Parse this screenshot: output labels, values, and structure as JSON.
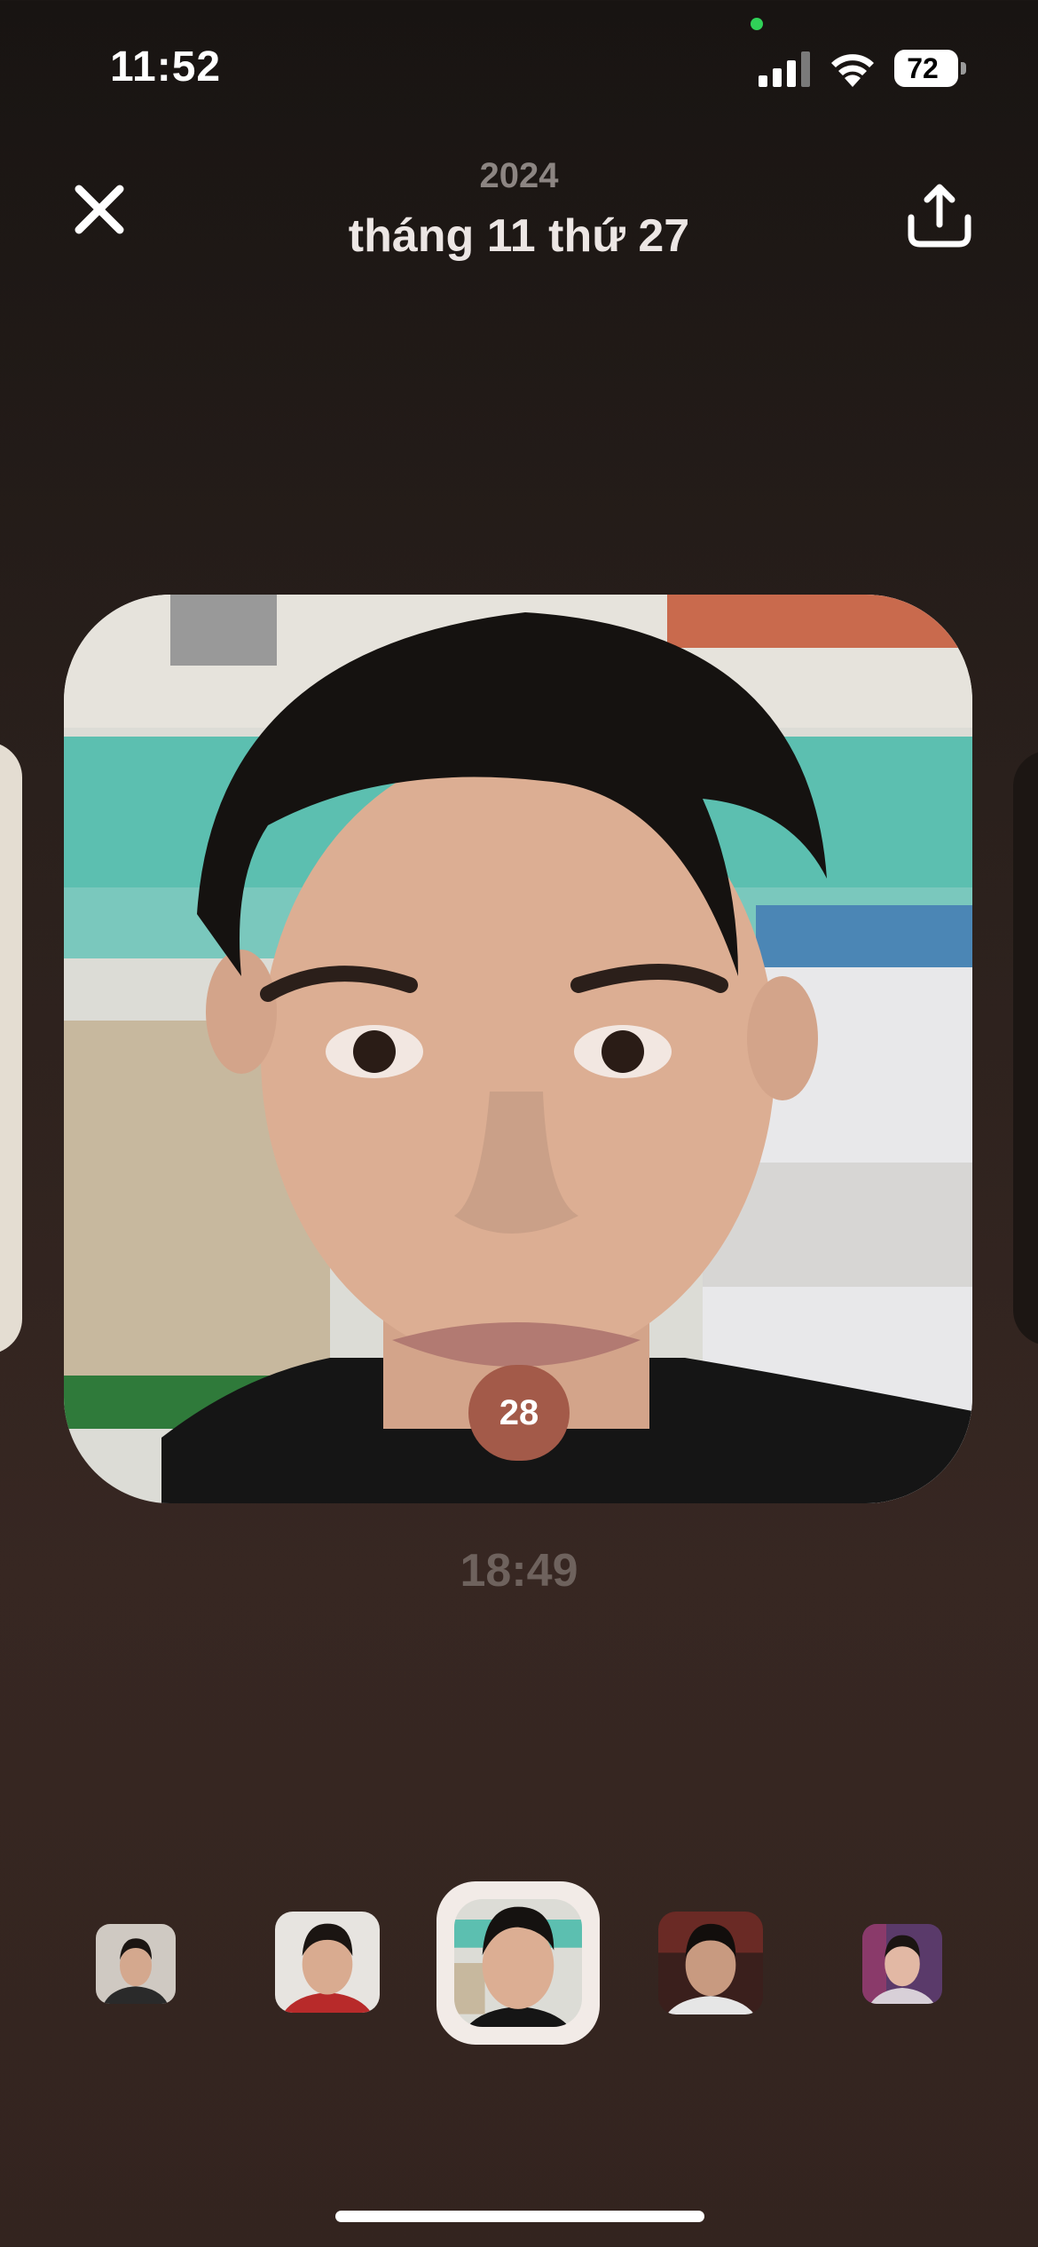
{
  "status_bar": {
    "time": "11:52",
    "battery": "72",
    "icons": [
      "cell-signal-icon",
      "wifi-icon",
      "battery-icon"
    ]
  },
  "header": {
    "year": "2024",
    "date": "tháng 11 thứ 27",
    "close_icon": "close-icon",
    "share_icon": "share-icon"
  },
  "photo": {
    "day_badge": "28",
    "time": "18:49"
  },
  "thumbnails": {
    "count": 5,
    "selected_index": 2
  },
  "colors": {
    "badge": "#a35a49",
    "selected_frame": "#f2ebe7",
    "time_text": "#6e625d",
    "year_text": "#8c8582"
  }
}
